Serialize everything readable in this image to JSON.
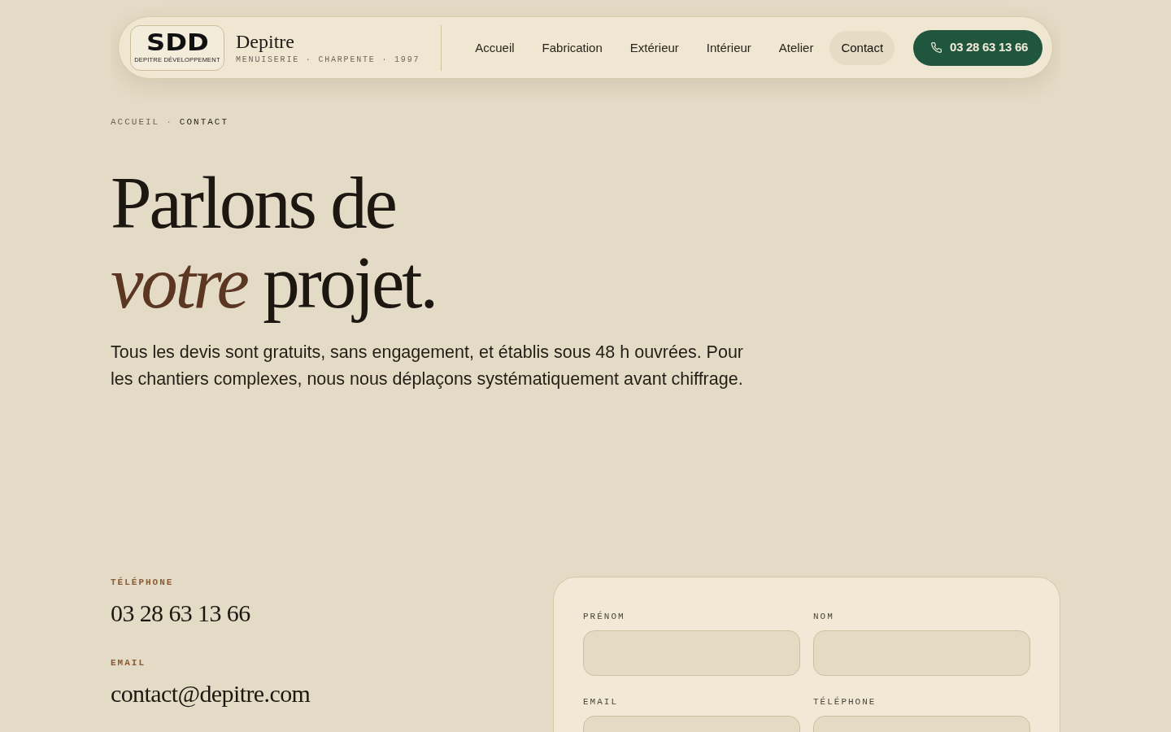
{
  "header": {
    "logo": {
      "mark": "SDD",
      "tagline": "DEPITRE DÉVELOPPEMENT"
    },
    "brand": {
      "name": "Depitre",
      "subtitle": "MENUISERIE · CHARPENTE · 1997"
    },
    "nav": [
      {
        "label": "Accueil",
        "selected": false
      },
      {
        "label": "Fabrication",
        "selected": false
      },
      {
        "label": "Extérieur",
        "selected": false
      },
      {
        "label": "Intérieur",
        "selected": false
      },
      {
        "label": "Atelier",
        "selected": false
      },
      {
        "label": "Contact",
        "selected": true
      }
    ],
    "phone_button": {
      "label": "03 28 63 13 66"
    }
  },
  "breadcrumb": {
    "separator": "·",
    "items": [
      {
        "label": "ACCUEIL",
        "current": false
      },
      {
        "label": "CONTACT",
        "current": true
      }
    ]
  },
  "hero": {
    "title_lines": [
      "Parlons de",
      "*votre* projet."
    ],
    "intro": "Tous les devis sont gratuits, sans engagement, et établis sous 48 h ouvrées. Pour les chantiers complexes, nous nous déplaçons systématiquement avant chiffrage."
  },
  "contact_details": [
    {
      "label": "TÉLÉPHONE",
      "value": "03 28 63 13 66"
    },
    {
      "label": "EMAIL",
      "value": "contact@depitre.com"
    }
  ],
  "form": {
    "fields": [
      {
        "label": "PRÉNOM"
      },
      {
        "label": "NOM"
      },
      {
        "label": "EMAIL"
      },
      {
        "label": "TÉLÉPHONE"
      }
    ]
  }
}
